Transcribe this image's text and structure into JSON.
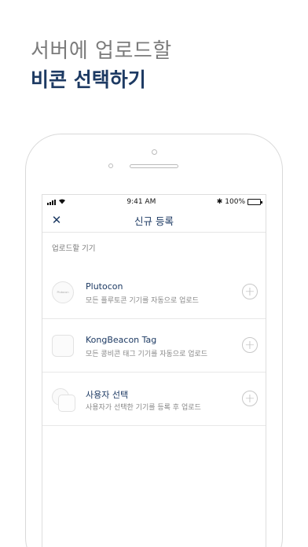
{
  "headline": {
    "line1": "서버에 업로드할",
    "line2": "비콘 선택하기"
  },
  "statusbar": {
    "wifi_icon": "wifi-icon",
    "time": "9:41 AM",
    "bluetooth_icon": "bluetooth-icon",
    "bluetooth_glyph": "✱",
    "battery_percent": "100%",
    "battery_level": 1.0
  },
  "navbar": {
    "close_glyph": "✕",
    "title": "신규 등록"
  },
  "section": {
    "label": "업로드할 기기"
  },
  "items": [
    {
      "name": "Plutocon",
      "desc": "모든 플루토콘 기기를 자동으로 업로드",
      "icon": "plutocon-beacon-icon",
      "add_glyph": "+"
    },
    {
      "name": "KongBeacon Tag",
      "desc": "모든 콩비콘 태그 기기를 자동으로 업로드",
      "icon": "kongbeacon-tag-icon",
      "add_glyph": "+"
    },
    {
      "name": "사용자 선택",
      "desc": "사용자가 선택한 기기를 등록 후 업로드",
      "icon": "user-select-beacons-icon",
      "add_glyph": "+"
    }
  ],
  "colors": {
    "accent": "#1d3a63",
    "headline_gray": "#7b7b7b"
  }
}
